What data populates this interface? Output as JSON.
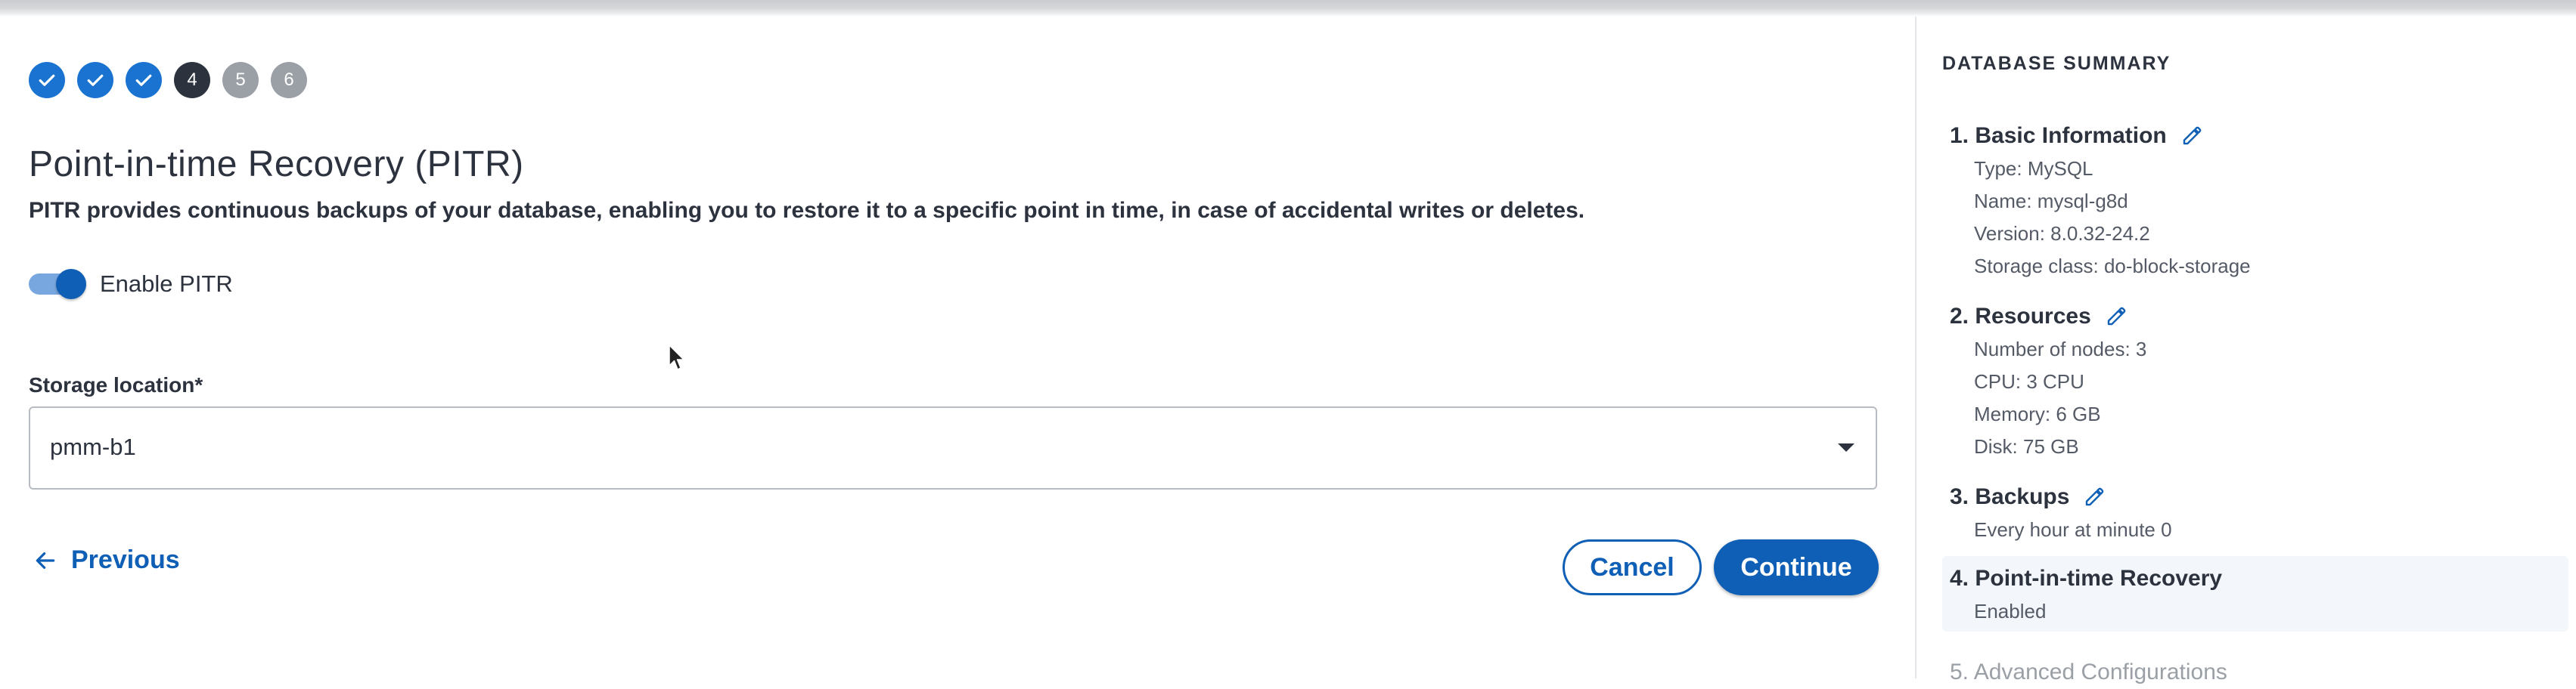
{
  "stepper": {
    "steps": [
      {
        "label": "",
        "state": "done"
      },
      {
        "label": "",
        "state": "done"
      },
      {
        "label": "",
        "state": "done"
      },
      {
        "label": "4",
        "state": "current"
      },
      {
        "label": "5",
        "state": "todo"
      },
      {
        "label": "6",
        "state": "todo"
      }
    ]
  },
  "form": {
    "title": "Point-in-time Recovery (PITR)",
    "description": "PITR provides continuous backups of your database, enabling you to restore it to a specific point in time, in case of accidental writes or deletes.",
    "toggle_label": "Enable PITR",
    "toggle_on": true,
    "storage_label": "Storage location*",
    "storage_value": "pmm-b1"
  },
  "actions": {
    "previous": "Previous",
    "cancel": "Cancel",
    "continue": "Continue"
  },
  "summary": {
    "title": "DATABASE SUMMARY",
    "sections": [
      {
        "heading": "1. Basic Information",
        "editable": true,
        "rows": [
          "Type: MySQL",
          "Name: mysql-g8d",
          "Version: 8.0.32-24.2",
          "Storage class: do-block-storage"
        ]
      },
      {
        "heading": "2. Resources",
        "editable": true,
        "rows": [
          "Number of nodes: 3",
          "CPU: 3 CPU",
          "Memory: 6 GB",
          "Disk: 75 GB"
        ]
      },
      {
        "heading": "3. Backups",
        "editable": true,
        "rows": [
          "Every hour at minute 0"
        ]
      },
      {
        "heading": "4. Point-in-time Recovery",
        "editable": false,
        "rows": [
          "Enabled"
        ]
      },
      {
        "heading": "5. Advanced Configurations",
        "editable": false,
        "rows": []
      }
    ]
  },
  "colors": {
    "primary": "#0e5fb5",
    "step_done": "#1a73d1",
    "step_current": "#2c323e",
    "step_todo": "#9aa0a6",
    "text": "#2c323e"
  },
  "icons": {
    "step_done": "check-icon",
    "edit": "pencil-icon",
    "previous": "arrow-left-icon",
    "select": "caret-down-icon",
    "cursor": "mouse-pointer-icon"
  }
}
